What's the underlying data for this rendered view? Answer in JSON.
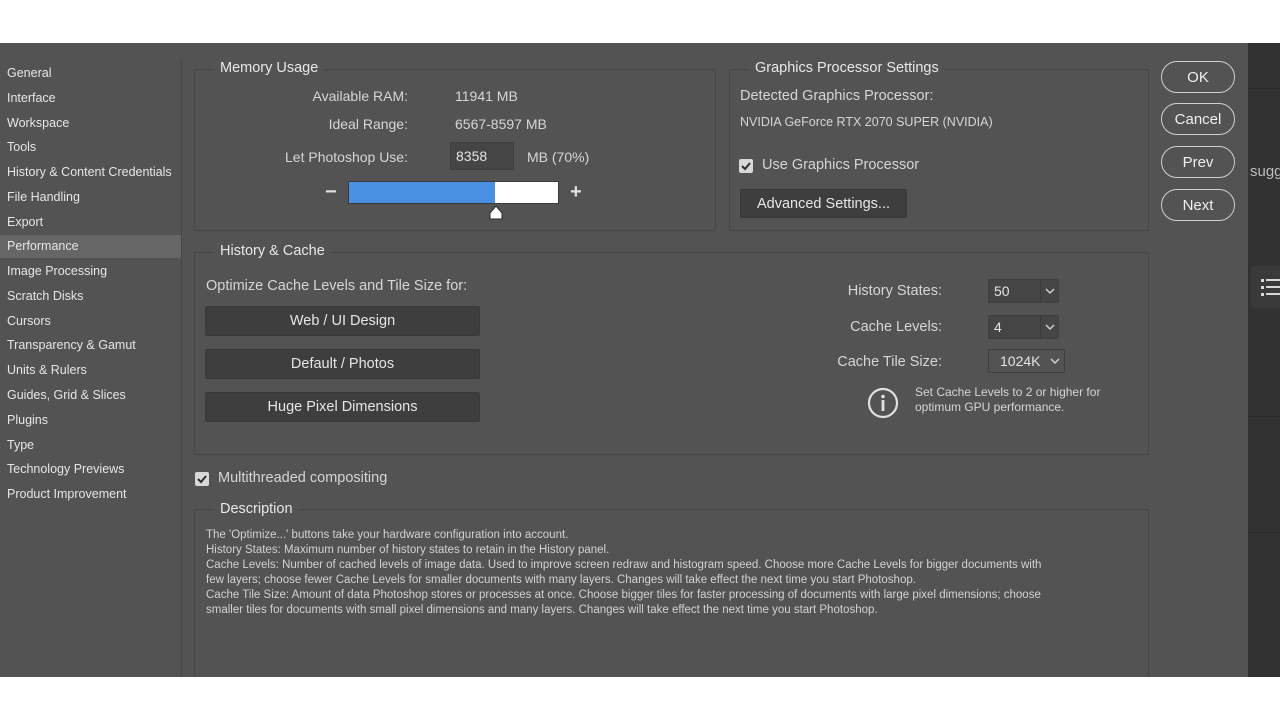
{
  "sidebar": {
    "items": [
      {
        "label": "General"
      },
      {
        "label": "Interface"
      },
      {
        "label": "Workspace"
      },
      {
        "label": "Tools"
      },
      {
        "label": "History & Content Credentials"
      },
      {
        "label": "File Handling"
      },
      {
        "label": "Export"
      },
      {
        "label": "Performance",
        "active": true
      },
      {
        "label": "Image Processing"
      },
      {
        "label": "Scratch Disks"
      },
      {
        "label": "Cursors"
      },
      {
        "label": "Transparency & Gamut"
      },
      {
        "label": "Units & Rulers"
      },
      {
        "label": "Guides, Grid & Slices"
      },
      {
        "label": "Plugins"
      },
      {
        "label": "Type"
      },
      {
        "label": "Technology Previews"
      },
      {
        "label": "Product Improvement"
      }
    ]
  },
  "memory": {
    "title": "Memory Usage",
    "available_label": "Available RAM:",
    "available_value": "11941 MB",
    "ideal_label": "Ideal Range:",
    "ideal_value": "6567-8597 MB",
    "let_label": "Let Photoshop Use:",
    "let_value": "8358",
    "let_unit": "MB (70%)",
    "minus": "−",
    "plus": "+",
    "slider_fraction": 0.7
  },
  "gpu": {
    "title": "Graphics Processor Settings",
    "detected_label": "Detected Graphics Processor:",
    "detected_value": "NVIDIA GeForce RTX 2070 SUPER (NVIDIA)",
    "use_label": "Use Graphics Processor",
    "use_checked": true,
    "advanced_label": "Advanced Settings..."
  },
  "dialog_buttons": {
    "ok": "OK",
    "cancel": "Cancel",
    "prev": "Prev",
    "next": "Next"
  },
  "history": {
    "title": "History & Cache",
    "optimize_label": "Optimize Cache Levels and Tile Size for:",
    "preset_buttons": [
      "Web / UI Design",
      "Default / Photos",
      "Huge Pixel Dimensions"
    ],
    "history_states_label": "History States:",
    "history_states_value": "50",
    "cache_levels_label": "Cache Levels:",
    "cache_levels_value": "4",
    "cache_tile_label": "Cache Tile Size:",
    "cache_tile_value": "1024K",
    "info_line1": "Set Cache Levels to 2 or higher for",
    "info_line2": "optimum GPU performance."
  },
  "multithreaded": {
    "label": "Multithreaded compositing",
    "checked": true
  },
  "description": {
    "title": "Description",
    "lines": [
      "The 'Optimize...' buttons take your hardware configuration into account.",
      "History States: Maximum number of history states to retain in the History panel.",
      "Cache Levels: Number of cached levels of image data.  Used to improve screen redraw and histogram speed.  Choose more Cache Levels for bigger documents with",
      "few layers; choose fewer Cache Levels for smaller documents with many layers. Changes will take effect the next time you start Photoshop.",
      "Cache Tile Size: Amount of data Photoshop stores or processes at once. Choose bigger tiles for faster processing of documents with large pixel dimensions; choose",
      "smaller tiles for documents with small pixel dimensions and many layers. Changes will take effect the next time you start Photoshop."
    ]
  },
  "background_app": {
    "partial_text": "sugg"
  },
  "colors": {
    "dialog_bg": "#535353",
    "sidebar_active": "#666666",
    "slider_fill": "#4a90e2",
    "button_bg": "#3e3e3e"
  }
}
